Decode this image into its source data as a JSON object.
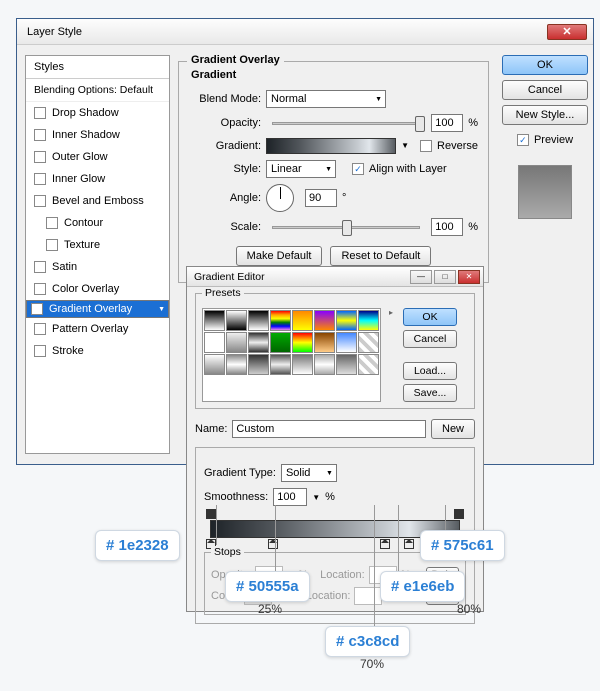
{
  "mainDialog": {
    "title": "Layer Style",
    "stylesHeader": "Styles",
    "blendingOptions": "Blending Options: Default",
    "items": [
      {
        "label": "Drop Shadow",
        "checked": false
      },
      {
        "label": "Inner Shadow",
        "checked": false
      },
      {
        "label": "Outer Glow",
        "checked": false
      },
      {
        "label": "Inner Glow",
        "checked": false
      },
      {
        "label": "Bevel and Emboss",
        "checked": false
      },
      {
        "label": "Contour",
        "checked": false,
        "indent": true
      },
      {
        "label": "Texture",
        "checked": false,
        "indent": true
      },
      {
        "label": "Satin",
        "checked": false
      },
      {
        "label": "Color Overlay",
        "checked": false
      },
      {
        "label": "Gradient Overlay",
        "checked": true,
        "selected": true
      },
      {
        "label": "Pattern Overlay",
        "checked": false
      },
      {
        "label": "Stroke",
        "checked": false
      }
    ],
    "panel": {
      "title": "Gradient Overlay",
      "sub": "Gradient",
      "blendMode": {
        "label": "Blend Mode:",
        "value": "Normal"
      },
      "opacity": {
        "label": "Opacity:",
        "value": "100",
        "unit": "%"
      },
      "gradient": {
        "label": "Gradient:",
        "reverse": "Reverse"
      },
      "style": {
        "label": "Style:",
        "value": "Linear",
        "align": "Align with Layer"
      },
      "angle": {
        "label": "Angle:",
        "value": "90",
        "unit": "°"
      },
      "scale": {
        "label": "Scale:",
        "value": "100",
        "unit": "%"
      },
      "makeDefault": "Make Default",
      "resetDefault": "Reset to Default"
    },
    "buttons": {
      "ok": "OK",
      "cancel": "Cancel",
      "newStyle": "New Style...",
      "preview": "Preview"
    }
  },
  "gradEditor": {
    "title": "Gradient Editor",
    "presets": "Presets",
    "ok": "OK",
    "cancel": "Cancel",
    "load": "Load...",
    "save": "Save...",
    "nameLbl": "Name:",
    "nameVal": "Custom",
    "new": "New",
    "typeLbl": "Gradient Type:",
    "typeVal": "Solid",
    "smoothLbl": "Smoothness:",
    "smoothVal": "100",
    "smoothUnit": "%",
    "stopsLbl": "Stops",
    "opacityLbl": "Opacity:",
    "locationLbl": "Location:",
    "colorLbl": "Color:",
    "delete": "Dele",
    "pct": "%",
    "swatchColors": [
      "linear-gradient(#000,#fff)",
      "linear-gradient(#fff,#000)",
      "linear-gradient(#000,transparent)",
      "linear-gradient(red,orange,yellow,green,blue,violet)",
      "linear-gradient(#f80,#ff0)",
      "linear-gradient(#80f,#f80)",
      "linear-gradient(#06f,#ff0,#06f)",
      "linear-gradient(#008,#0ff,#ff0)",
      "linear-gradient(#fff,#fff)",
      "linear-gradient(#eee,#888)",
      "linear-gradient(#333,#eee,#333)",
      "linear-gradient(#0a0,#060)",
      "linear-gradient(#f00,#ff0,#0f0)",
      "linear-gradient(#840,#fc8)",
      "linear-gradient(#48f,#fff)",
      "repeating-linear-gradient(45deg,#ccc 0 4px,#fff 4px 8px)",
      "linear-gradient(#fff,#888)",
      "linear-gradient(#888,#fff,#888)",
      "linear-gradient(#333,#ccc)",
      "linear-gradient(#555,#eee,#555)",
      "linear-gradient(#777,#fff)",
      "linear-gradient(#aaa,#fff,#aaa)",
      "linear-gradient(#666,#ddd)",
      "repeating-linear-gradient(45deg,#ccc 0 4px,#fff 4px 8px)"
    ]
  },
  "callouts": {
    "c1": "# 1e2328",
    "c2": "# 50555a",
    "c3": "# c3c8cd",
    "c4": "# e1e6eb",
    "c5": "# 575c61",
    "p25": "25%",
    "p70": "70%",
    "p80": "80%"
  }
}
